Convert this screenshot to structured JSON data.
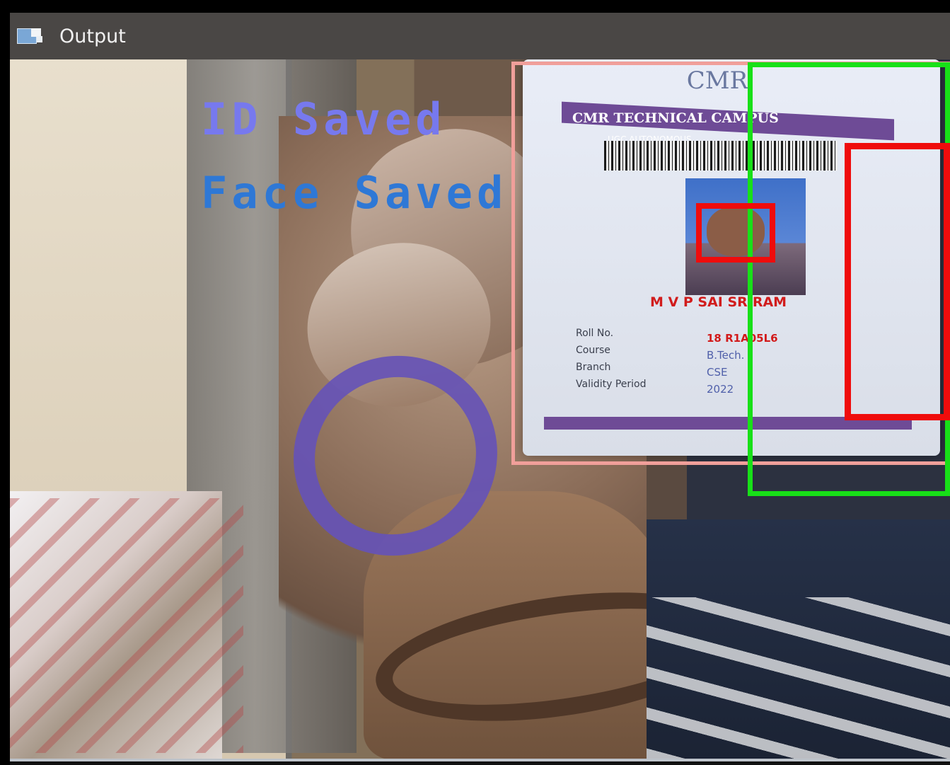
{
  "window": {
    "title": "Output",
    "app_icon": "window-icon"
  },
  "overlay_text": {
    "id_status": "ID Saved",
    "face_status": "Face Saved"
  },
  "card": {
    "brand_top": "CMR",
    "header": "CMR TECHNICAL CAMPUS",
    "sub_header": "UGC AUTONOMOUS",
    "name": "M V P SAI SRIRAM",
    "fields": [
      "Roll No.",
      "Course",
      "Branch",
      "Validity Period"
    ],
    "values": [
      "18 R1A05L6",
      "B.Tech.",
      "CSE",
      "2022"
    ]
  },
  "colors": {
    "title_bar": "#4a4745",
    "id_text": "#7779ee",
    "face_text": "#2e78d6",
    "card_box": "#f09f9a",
    "green_box": "#18e018",
    "red_box": "#ef0c0c"
  }
}
